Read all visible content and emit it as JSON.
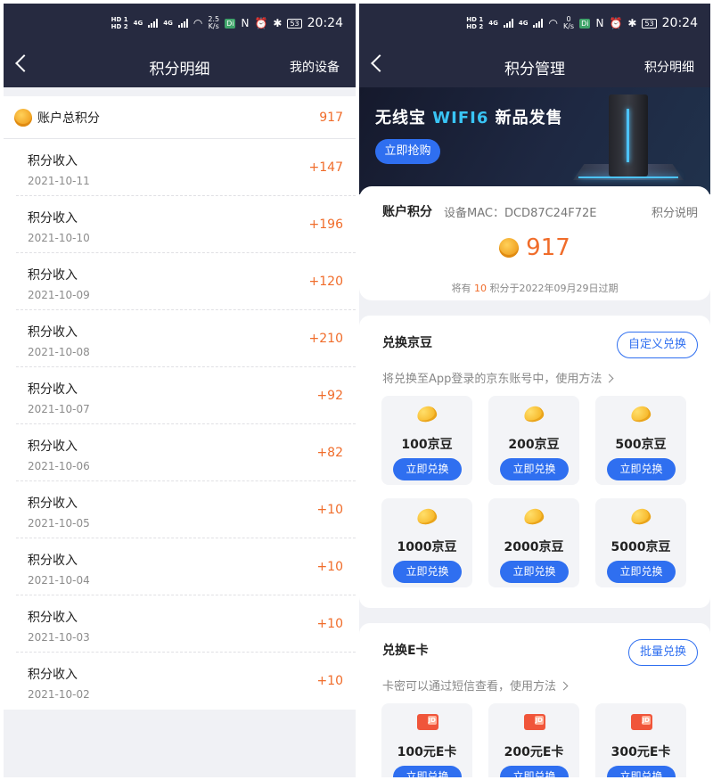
{
  "status_bar": {
    "hd1": "HD 1",
    "hd2": "HD 2",
    "net1": "4G",
    "net2": "4G",
    "left_rate_value": "2.5",
    "right_rate_value": "0",
    "rate_unit": "K/s",
    "di": "Di",
    "nfc": "N",
    "battery": "53",
    "time": "20:24"
  },
  "left": {
    "nav": {
      "title": "积分明细",
      "right": "我的设备"
    },
    "total": {
      "label": "账户总积分",
      "value": "917"
    },
    "records": [
      {
        "title": "积分收入",
        "date": "2021-10-11",
        "points": "+147"
      },
      {
        "title": "积分收入",
        "date": "2021-10-10",
        "points": "+196"
      },
      {
        "title": "积分收入",
        "date": "2021-10-09",
        "points": "+120"
      },
      {
        "title": "积分收入",
        "date": "2021-10-08",
        "points": "+210"
      },
      {
        "title": "积分收入",
        "date": "2021-10-07",
        "points": "+92"
      },
      {
        "title": "积分收入",
        "date": "2021-10-06",
        "points": "+82"
      },
      {
        "title": "积分收入",
        "date": "2021-10-05",
        "points": "+10"
      },
      {
        "title": "积分收入",
        "date": "2021-10-04",
        "points": "+10"
      },
      {
        "title": "积分收入",
        "date": "2021-10-03",
        "points": "+10"
      },
      {
        "title": "积分收入",
        "date": "2021-10-02",
        "points": "+10"
      }
    ]
  },
  "right": {
    "nav": {
      "title": "积分管理",
      "right": "积分明细"
    },
    "banner": {
      "title_prefix": "无线宝 ",
      "title_highlight": "WIFI6",
      "title_suffix": " 新品发售",
      "button": "立即抢购"
    },
    "account": {
      "label": "账户积分",
      "mac_label": "设备MAC：",
      "mac": "DCD87C24F72E",
      "help": "积分说明",
      "points": "917",
      "expire_prefix": "将有 ",
      "expire_amount": "10",
      "expire_suffix": " 积分于2022年09月29日过期"
    },
    "beans": {
      "title": "兑换京豆",
      "button": "自定义兑换",
      "desc": "将兑换至App登录的京东账号中，使用方法",
      "items": [
        {
          "label": "100京豆",
          "action": "立即兑换",
          "icon": "bean-icon"
        },
        {
          "label": "200京豆",
          "action": "立即兑换",
          "icon": "bean-icon"
        },
        {
          "label": "500京豆",
          "action": "立即兑换",
          "icon": "bean-icon"
        },
        {
          "label": "1000京豆",
          "action": "立即兑换",
          "icon": "bean-icon"
        },
        {
          "label": "2000京豆",
          "action": "立即兑换",
          "icon": "bean-icon"
        },
        {
          "label": "5000京豆",
          "action": "立即兑换",
          "icon": "bean-icon"
        }
      ]
    },
    "ecard": {
      "title": "兑换E卡",
      "button": "批量兑换",
      "desc": "卡密可以通过短信查看，使用方法",
      "items": [
        {
          "label": "100元E卡",
          "action": "立即兑换",
          "icon": "jd-ecard-icon"
        },
        {
          "label": "200元E卡",
          "action": "立即兑换",
          "icon": "jd-ecard-icon"
        },
        {
          "label": "300元E卡",
          "action": "立即兑换",
          "icon": "jd-ecard-icon"
        }
      ]
    }
  },
  "colors": {
    "header_bg": "#262a40",
    "accent_orange": "#f06c2a",
    "accent_blue": "#2f6ff0",
    "page_bg": "#f0f1f5"
  }
}
